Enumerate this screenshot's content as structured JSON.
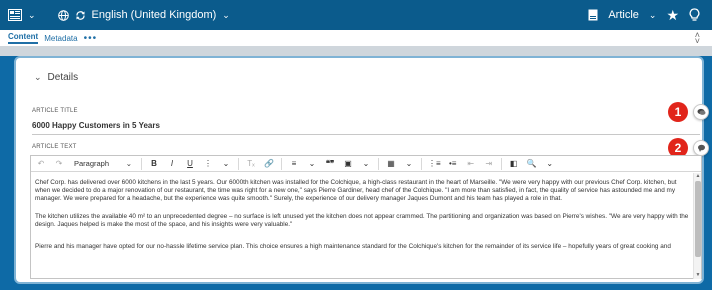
{
  "topbar": {
    "language": "English (United Kingdom)",
    "content_type": "Article"
  },
  "tabs": [
    {
      "label": "Content",
      "active": true
    },
    {
      "label": "Metadata",
      "active": false
    }
  ],
  "tabs_more": "•••",
  "details": {
    "section_title": "Details",
    "article_title_label": "ARTICLE TITLE",
    "article_title_value": "6000 Happy Customers in 5 Years",
    "article_text_label": "ARTICLE TEXT"
  },
  "badges": [
    "1",
    "2"
  ],
  "editor": {
    "paragraph_style": "Paragraph",
    "toolbar": {
      "bold": "B",
      "italic": "I",
      "underline": "U",
      "more": "⋮",
      "quote": "❝❞"
    },
    "paragraphs": [
      "Chef Corp. has delivered over 6000 kitchens in the last 5 years. Our 6000th kitchen was installed for the Colchique, a high-class restaurant in the heart of Marseille. \"We were very happy with our previous Chef Corp. kitchen, but when we decided to do a major renovation of our restaurant, the time was right for a new one,\" says Pierre Gardiner, head chef of the Colchique. \"I am more than satisfied, in fact, the quality of service has astounded me and my manager. We were prepared for a headache, but the experience was quite smooth.\" Surely, the experience of our delivery manager Jaques Dumont and his team has played a role in that.",
      "The kitchen utilizes the available 40 m² to an unprecedented degree – no surface is left unused yet the kitchen does not appear crammed. The partitioning and organization was based on Pierre's wishes. \"We are very happy with the design. Jaques helped is make the most of the space, and his insights were very valuable.\"",
      "Pierre and his manager have opted for our no-hassle lifetime service plan. This choice ensures a high maintenance standard for the Colchique's kitchen for the remainder of its service life – hopefully years of great cooking and"
    ]
  },
  "colors": {
    "topbar": "#0b5b8c",
    "canvas": "#0e6aa6",
    "accent": "#1f6fa6",
    "badge": "#e1251b"
  }
}
